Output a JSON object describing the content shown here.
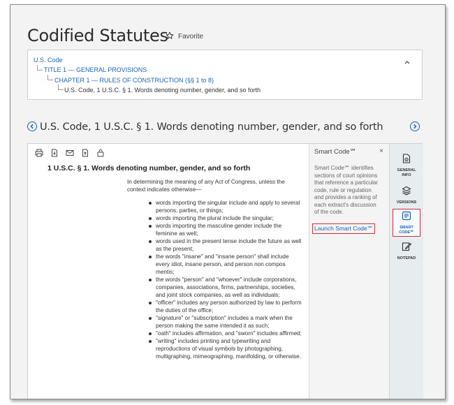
{
  "page": {
    "title": "Codified Statutes",
    "favorite_label": "Favorite"
  },
  "breadcrumb": {
    "level1": "U.S. Code",
    "level2": "TITLE 1 — GENERAL PROVISIONS",
    "level3": "CHAPTER 1 — RULES OF CONSTRUCTION (§§ 1 to 8)",
    "level4": "U.S. Code, 1 U.S.C. § 1. Words denoting number, gender, and so forth"
  },
  "document": {
    "title": "U.S. Code, 1 U.S.C. § 1. Words denoting number, gender, and so forth",
    "section_heading": "1 U.S.C. § 1. Words denoting number, gender, and so forth",
    "intro": "In determining the meaning of any Act of Congress, unless the context indicates otherwise—",
    "items": [
      "words importing the singular include and apply to several persons, parties, or things;",
      "words importing the plural include the singular;",
      "words importing the masculine gender include the feminine as well;",
      "words used in the present tense include the future as well as the present;",
      "the words \"insane\" and \"insane person\" shall include every idiot, insane person, and person non compos mentis;",
      "the words \"person\" and \"whoever\" include corporations, companies, associations, firms, partnerships, societies, and joint stock companies, as well as individuals;",
      "\"officer\" includes any person authorized by law to perform the duties of the office;",
      "\"signature\" or \"subscription\" includes a mark when the person making the same intended it as such;",
      "\"oath\" includes affirmation, and \"sworn\" includes affirmed;",
      "\"writing\" includes printing and typewriting and reproductions of visual symbols by photographing, multigraphing, mimeographing, manifolding, or otherwise."
    ]
  },
  "toolbar": {
    "icons": [
      "print-icon",
      "download-icon",
      "email-icon",
      "export-icon",
      "lock-icon"
    ]
  },
  "smart_code": {
    "title": "Smart Code℠",
    "close": "×",
    "description": "Smart Code℠ identifies sections of court opinions that reference a particular code, rule or regulation and provides a ranking of each extract's discussion of the code.",
    "launch_label": "Launch Smart Code℠"
  },
  "rail": {
    "general_info": "GENERAL INFO",
    "versions": "VERSIONS",
    "smart_code": "SMART CODE℠",
    "notepad": "NOTEPAD"
  },
  "colors": {
    "link": "#1a64b4",
    "highlight": "#d0303a",
    "rail_bg": "#e7ecef"
  }
}
